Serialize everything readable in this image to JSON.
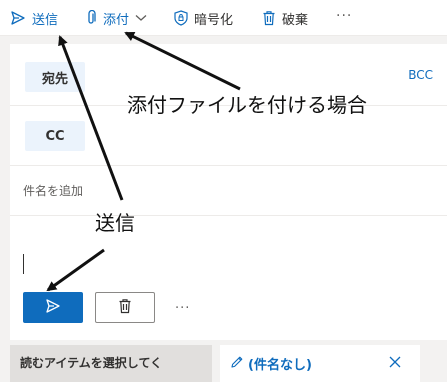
{
  "toolbar": {
    "send_label": "送信",
    "attach_label": "添付",
    "encrypt_label": "暗号化",
    "discard_label": "破棄",
    "more_label": "···"
  },
  "compose": {
    "to_label": "宛先",
    "cc_label": "CC",
    "bcc_label": "BCC",
    "subject_placeholder": "件名を追加",
    "more_label": "···"
  },
  "tabs": {
    "reading_label": "読むアイテムを選択してく",
    "draft_label": "(件名なし)"
  },
  "annotations": {
    "attach_note": "添付ファイルを付ける場合",
    "send_note": "送信"
  },
  "icons": {
    "send": "send-icon",
    "attach": "paperclip-icon",
    "chevron": "chevron-down-icon",
    "encrypt": "shield-icon",
    "discard": "trash-icon",
    "pencil": "pencil-icon",
    "close": "close-icon"
  },
  "colors": {
    "accent": "#0f6cbd",
    "pill_bg": "#ebf3fc"
  }
}
